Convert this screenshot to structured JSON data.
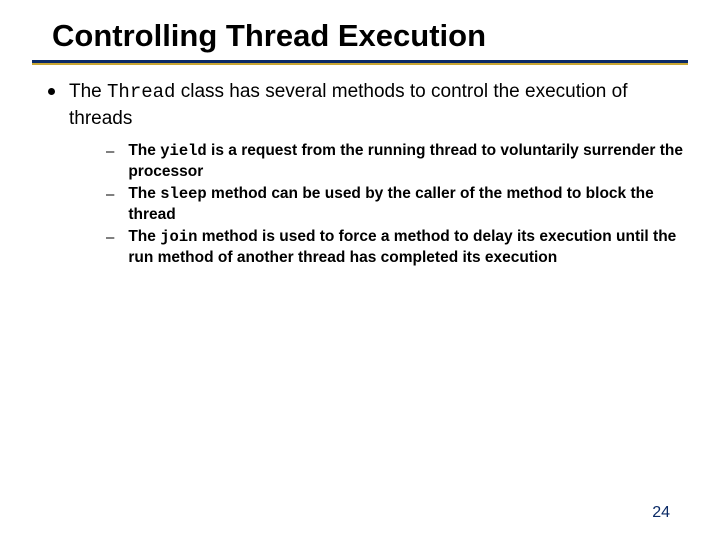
{
  "slide": {
    "title": "Controlling Thread Execution",
    "main_bullet": {
      "pre": "The ",
      "code": "Thread",
      "post": " class has several methods to control the execution of threads"
    },
    "sub_bullets": [
      {
        "pre": "The ",
        "code": "yield",
        "post": " is a request from the running thread to voluntarily surrender the processor"
      },
      {
        "pre": "The ",
        "code": "sleep",
        "post": " method can be used by the caller of the method to block the thread"
      },
      {
        "pre": "The ",
        "code": "join",
        "post": " method is used to force a method to delay its execution until the run method of another thread has completed its execution"
      }
    ],
    "page_number": "24"
  }
}
